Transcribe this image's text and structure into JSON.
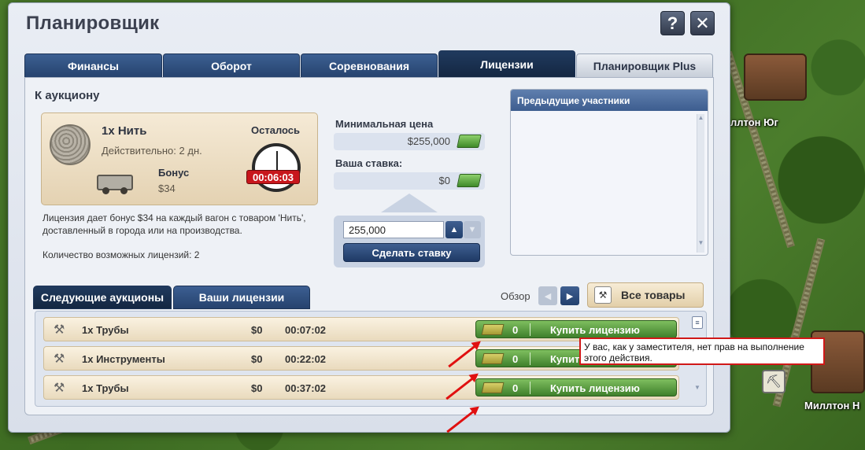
{
  "window": {
    "title": "Планировщик",
    "help_label": "?",
    "close_label": "✕"
  },
  "tabs": [
    {
      "label": "Финансы",
      "active": false
    },
    {
      "label": "Оборот",
      "active": false
    },
    {
      "label": "Соревнования",
      "active": false
    },
    {
      "label": "Лицензии",
      "active": true
    },
    {
      "label": "Планировщик Plus",
      "active": false
    }
  ],
  "auction": {
    "section_title": "К аукциону",
    "goods": "1x Нить",
    "valid": "Действительно: 2 дн.",
    "bonus_label": "Бонус",
    "bonus_value": "$34",
    "remaining_label": "Осталось",
    "remaining_time": "00:06:03",
    "description": "Лицензия дает бонус $34 на каждый вагон с товаром 'Нить', доставленный в города или на производства.",
    "licenses_count": "Количество возможных лицензий: 2",
    "min_price_label": "Минимальная цена",
    "min_price_value": "$255,000",
    "your_bid_label": "Ваша ставка:",
    "your_bid_value": "$0",
    "bid_input_value": "255,000",
    "place_bid_label": "Сделать ставку"
  },
  "previous": {
    "title": "Предыдущие участники"
  },
  "lower_tabs": [
    {
      "label": "Следующие аукционы",
      "active": true
    },
    {
      "label": "Ваши лицензии",
      "active": false
    }
  ],
  "browse": {
    "overview_label": "Обзор",
    "all_goods_label": "Все товары"
  },
  "auctions": [
    {
      "icon": "pipe-icon",
      "name": "1x Трубы",
      "price": "$0",
      "time": "00:07:02",
      "count": "0",
      "buy_label": "Купить лицензию"
    },
    {
      "icon": "tools-icon",
      "name": "1x Инструменты",
      "price": "$0",
      "time": "00:22:02",
      "count": "0",
      "buy_label": "Купить лицензию"
    },
    {
      "icon": "pipe-icon",
      "name": "1x Трубы",
      "price": "$0",
      "time": "00:37:02",
      "count": "0",
      "buy_label": "Купить лицензию"
    }
  ],
  "tooltip": {
    "text": "У вас, как у заместителя, нет прав на выполнение этого действия."
  },
  "map": {
    "city_top": "ллтон Юг",
    "city_bottom": "Миллтон Н"
  },
  "colors": {
    "tab_blue": "#26436e",
    "buy_green": "#3e7f2b",
    "alert_red": "#d01818"
  }
}
